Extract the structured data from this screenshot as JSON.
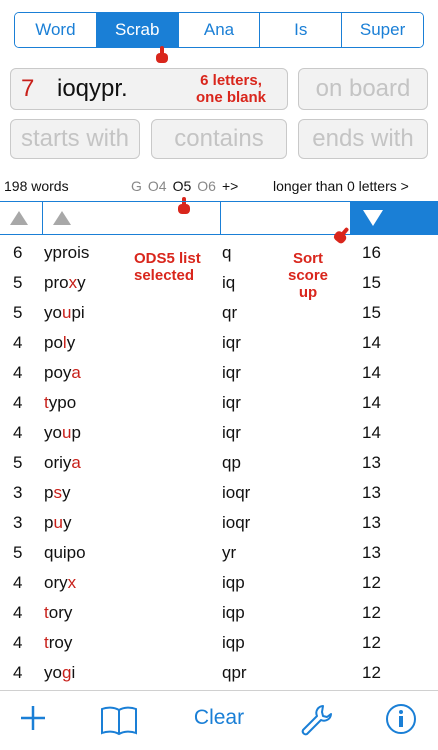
{
  "modes": [
    "Word",
    "Scrab",
    "Ana",
    "Is",
    "Super"
  ],
  "active_mode": "Scrab",
  "letters": {
    "count": "7",
    "value": "ioqypr."
  },
  "fields": {
    "on_board": "on board",
    "starts_with": "starts with",
    "contains": "contains",
    "ends_with": "ends with"
  },
  "annotations": {
    "letters_line1": "6 letters,",
    "letters_line2": "one blank",
    "list_line1": "ODS5 list",
    "list_line2": "selected",
    "sort_line1": "Sort",
    "sort_line2": "score",
    "sort_line3": "up"
  },
  "status": {
    "word_count": "198 words",
    "lists": [
      "G",
      "O4",
      "O5",
      "O6",
      "+>"
    ],
    "selected_list": "O5",
    "longer_than": "longer than 0 letters >"
  },
  "rows": [
    {
      "len": "6",
      "word": [
        [
          "yprois",
          ""
        ]
      ],
      "blanks": "q",
      "score": "16"
    },
    {
      "len": "5",
      "word": [
        [
          "pro",
          ""
        ],
        [
          "x",
          "b"
        ],
        [
          "y",
          ""
        ]
      ],
      "blanks": "iq",
      "score": "15"
    },
    {
      "len": "5",
      "word": [
        [
          "yo",
          ""
        ],
        [
          "u",
          "b"
        ],
        [
          "pi",
          ""
        ]
      ],
      "blanks": "qr",
      "score": "15"
    },
    {
      "len": "4",
      "word": [
        [
          "po",
          ""
        ],
        [
          "l",
          "b"
        ],
        [
          "y",
          ""
        ]
      ],
      "blanks": "iqr",
      "score": "14"
    },
    {
      "len": "4",
      "word": [
        [
          "poy",
          ""
        ],
        [
          "a",
          "b"
        ]
      ],
      "blanks": "iqr",
      "score": "14"
    },
    {
      "len": "4",
      "word": [
        [
          "t",
          "b"
        ],
        [
          "ypo",
          ""
        ]
      ],
      "blanks": "iqr",
      "score": "14"
    },
    {
      "len": "4",
      "word": [
        [
          "yo",
          ""
        ],
        [
          "u",
          "b"
        ],
        [
          "p",
          ""
        ]
      ],
      "blanks": "iqr",
      "score": "14"
    },
    {
      "len": "5",
      "word": [
        [
          "oriy",
          ""
        ],
        [
          "a",
          "b"
        ]
      ],
      "blanks": "qp",
      "score": "13"
    },
    {
      "len": "3",
      "word": [
        [
          "p",
          ""
        ],
        [
          "s",
          "b"
        ],
        [
          "y",
          ""
        ]
      ],
      "blanks": "ioqr",
      "score": "13"
    },
    {
      "len": "3",
      "word": [
        [
          "p",
          ""
        ],
        [
          "u",
          "b"
        ],
        [
          "y",
          ""
        ]
      ],
      "blanks": "ioqr",
      "score": "13"
    },
    {
      "len": "5",
      "word": [
        [
          "quipo",
          ""
        ]
      ],
      "blanks": "yr",
      "score": "13"
    },
    {
      "len": "4",
      "word": [
        [
          "ory",
          ""
        ],
        [
          "x",
          "b"
        ]
      ],
      "blanks": "iqp",
      "score": "12"
    },
    {
      "len": "4",
      "word": [
        [
          "t",
          "b"
        ],
        [
          "ory",
          ""
        ]
      ],
      "blanks": "iqp",
      "score": "12"
    },
    {
      "len": "4",
      "word": [
        [
          "t",
          "b"
        ],
        [
          "roy",
          ""
        ]
      ],
      "blanks": "iqp",
      "score": "12"
    },
    {
      "len": "4",
      "word": [
        [
          "yo",
          ""
        ],
        [
          "g",
          "b"
        ],
        [
          "i",
          ""
        ]
      ],
      "blanks": "qpr",
      "score": "12"
    }
  ],
  "toolbar": {
    "add_icon": "plus-icon",
    "book_icon": "book-icon",
    "clear_label": "Clear",
    "settings_icon": "wrench-icon",
    "info_icon": "info-icon"
  },
  "colors": {
    "accent": "#1a7fd6",
    "blank_letter": "#c8201a",
    "annotation": "#d9261c"
  }
}
